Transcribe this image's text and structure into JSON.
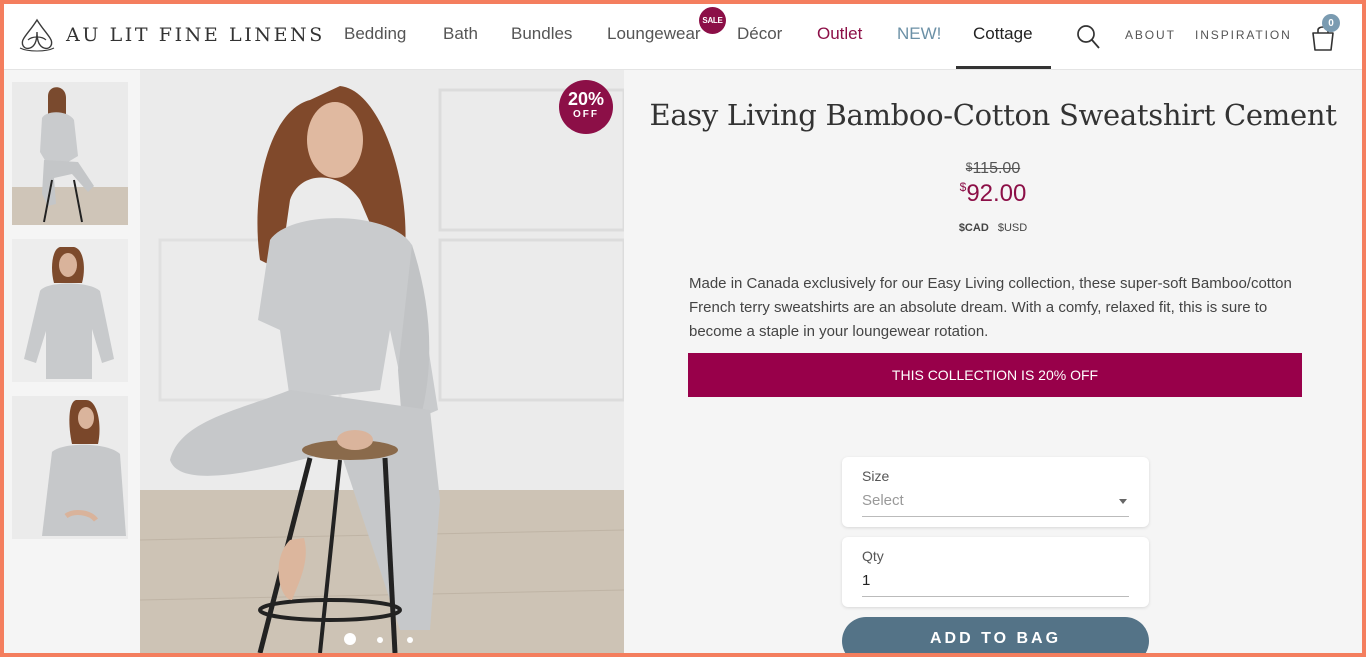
{
  "brand": {
    "name": "AU LIT FINE LINENS"
  },
  "nav": {
    "items": [
      {
        "label": "Bedding"
      },
      {
        "label": "Bath"
      },
      {
        "label": "Bundles"
      },
      {
        "label": "Loungewear"
      },
      {
        "label": "Décor"
      },
      {
        "label": "Outlet"
      },
      {
        "label": "NEW!"
      },
      {
        "label": "Cottage"
      }
    ],
    "sale_badge": "SALE",
    "active": "Cottage"
  },
  "utility": {
    "about": "ABOUT",
    "inspiration": "INSPIRATION",
    "bag_count": "0"
  },
  "gallery": {
    "thumbnails": [
      "thumb-1",
      "thumb-2",
      "thumb-3"
    ],
    "discount_pct": "20%",
    "discount_off": "OFF",
    "slide_count": 3,
    "active_slide": 1
  },
  "product": {
    "title": "Easy Living Bamboo-Cotton Sweatshirt Cement",
    "currency_symbol": "$",
    "old_price": "115.00",
    "new_price": "92.00",
    "currency_cad": "$CAD",
    "currency_usd": "$USD",
    "description": "Made in Canada exclusively for our Easy Living collection, these super-soft Bamboo/cotton French terry sweatshirts are an absolute dream. With a comfy, relaxed fit, this is sure to become a staple in your loungewear rotation.",
    "promo": "THIS COLLECTION IS 20% OFF"
  },
  "form": {
    "size_label": "Size",
    "size_placeholder": "Select",
    "qty_label": "Qty",
    "qty_value": "1",
    "add_button": "ADD TO BAG"
  },
  "colors": {
    "frame": "#f47e5e",
    "accent": "#8c0f47",
    "promo": "#98004a",
    "button": "#547387",
    "new_link": "#6b90a6",
    "bag_badge": "#7a9bb1"
  },
  "icons": [
    "logo-mark",
    "search-icon",
    "bag-icon"
  ]
}
